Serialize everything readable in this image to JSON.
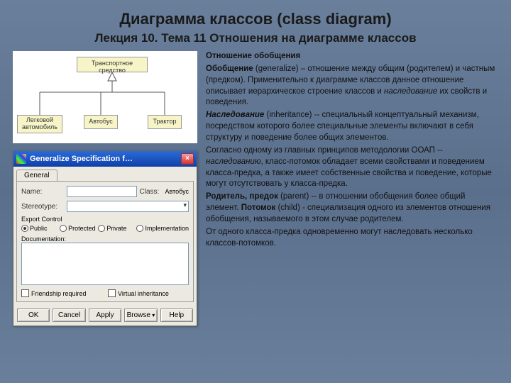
{
  "title": "Диаграмма классов (class diagram)",
  "subtitle": "Лекция 10. Тема 11 Отношения на диаграмме классов",
  "uml": {
    "parent": "Транспортное средство",
    "child1": "Легковой автомобиль",
    "child2": "Автобус",
    "child3": "Трактор"
  },
  "dialog": {
    "title": "Generalize Specification f…",
    "close": "×",
    "tab_general": "General",
    "name_lbl": "Name:",
    "class_lbl": "Class:",
    "class_val": "Автобус",
    "stereo_lbl": "Stereotype:",
    "export_lbl": "Export Control",
    "r_public": "Public",
    "r_protected": "Protected",
    "r_private": "Private",
    "r_impl": "Implementation",
    "doc_lbl": "Documentation:",
    "chk_friend": "Friendship required",
    "chk_virtual": "Virtual inheritance",
    "btn_ok": "OK",
    "btn_cancel": "Cancel",
    "btn_apply": "Apply",
    "btn_browse": "Browse",
    "btn_help": "Help"
  },
  "text": {
    "h1": "Отношение обобщения",
    "p1a": "Обобщение",
    "p1b": " (generalize) – отношение между общим (родителем) и частным (предком). Применительно к диаграмме классов данное отношение описывает иерархическое строение классов и ",
    "p1c": "наследование",
    "p1d": " их свойств и поведения.",
    "p2a": "Наследование",
    "p2b": " (inheritance) -- специальный концептуальный механизм, посредством которого более специальные элементы включают в себя структуру и поведение более общих элементов.",
    "p3a": "Согласно одному из главных принципов методологии ООАП -- ",
    "p3b": "наследованию",
    "p3c": ", класс-потомок обладает всеми свойствами и поведением класса-предка, а также имеет собственные свойства и поведение, которые могут отсутствовать у класса-предка.",
    "p4a": "Родитель, предок",
    "p4b": " (parent) -- в отношении обобщения более общий элемент. ",
    "p4c": "Потомок",
    "p4d": " (child) - специализация одного из элементов отношения обобщения, называемого в этом случае родителем.",
    "p5": "От одного класса-предка одновременно могут наследовать несколько классов-потомков."
  }
}
